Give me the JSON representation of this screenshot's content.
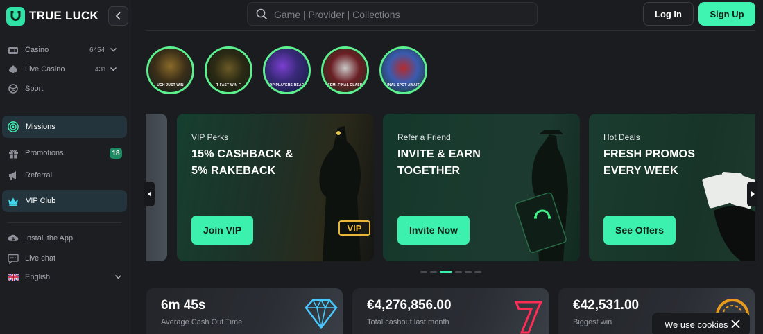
{
  "brand": {
    "name": "TRUE LUCK",
    "accent": "#3ff3b0"
  },
  "sidebar": {
    "items": [
      {
        "label": "Casino",
        "count": "6454",
        "icon": "casino-icon"
      },
      {
        "label": "Live Casino",
        "count": "431",
        "icon": "spade-icon"
      },
      {
        "label": "Sport",
        "icon": "ball-icon"
      },
      {
        "label": "Missions",
        "icon": "target-icon"
      },
      {
        "label": "Promotions",
        "badge": "18",
        "icon": "gift-icon"
      },
      {
        "label": "Referral",
        "icon": "megaphone-icon"
      },
      {
        "label": "VIP Club",
        "icon": "crown-icon"
      },
      {
        "label": "Install the App",
        "icon": "cloud-download-icon"
      },
      {
        "label": "Live chat",
        "icon": "chat-icon"
      },
      {
        "label": "English",
        "icon": "uk-flag-icon"
      }
    ]
  },
  "header": {
    "search_placeholder": "Game | Provider | Collections",
    "login_label": "Log In",
    "signup_label": "Sign Up"
  },
  "stories": [
    {
      "caption": "UCH JUST WIN"
    },
    {
      "caption": "T FAST WIN F"
    },
    {
      "caption": "OP PLAYERS READ"
    },
    {
      "caption": "SEMI-FINAL CLASH"
    },
    {
      "caption": "INAL SPOT AWAIT"
    }
  ],
  "banners": [
    {
      "subtitle": "VIP Perks",
      "title": "15% CASHBACK & 5% RAKEBACK",
      "cta": "Join VIP"
    },
    {
      "subtitle": "Refer a Friend",
      "title": "INVITE & EARN TOGETHER",
      "cta": "Invite Now"
    },
    {
      "subtitle": "Hot Deals",
      "title": "FRESH PROMOS EVERY WEEK",
      "cta": "See Offers"
    }
  ],
  "carousel": {
    "pages": 6,
    "active_page": 3
  },
  "stats": [
    {
      "value": "6m 45s",
      "caption": "Average Cash Out Time"
    },
    {
      "value": "€4,276,856.00",
      "caption": "Total cashout last month"
    },
    {
      "value": "€42,531.00",
      "caption": "Biggest win"
    }
  ],
  "cookie": {
    "text": "We use cookies"
  }
}
